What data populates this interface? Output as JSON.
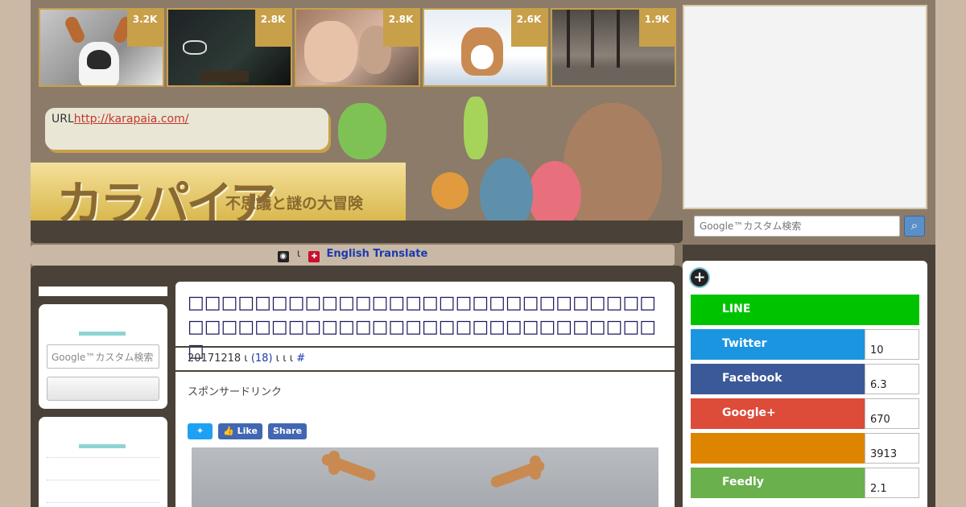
{
  "popular": [
    {
      "count": "3.2K",
      "subject": "husky-reindeer"
    },
    {
      "count": "2.8K",
      "subject": "night-photo"
    },
    {
      "count": "2.8K",
      "subject": "child-photo"
    },
    {
      "count": "2.6K",
      "subject": "corgi-snow"
    },
    {
      "count": "1.9K",
      "subject": "burnt-forest"
    }
  ],
  "header": {
    "url_label": "URL",
    "url_link": "http://karapaia.com/",
    "logo": "カラパイア",
    "tagline": "不思議と謎の大冒険"
  },
  "translate": {
    "sep": "ι",
    "link": "English Translate"
  },
  "search": {
    "placeholder": "Google™カスタム検索",
    "button_icon": "magnifier-icon"
  },
  "sidebar": {
    "search_placeholder": "Google™カスタム検索"
  },
  "article": {
    "title": "□□□□□□□□□□□□□□□□□□□□□□□□□□□□□□□□□□□□□□□□□□□□□□□□□□□□□□□□□",
    "meta_date": "20171218 ι",
    "meta_comments": "(18)",
    "meta_sep": " ι  ι    ι ",
    "meta_hash": "#",
    "sponsor": "スポンサードリンク",
    "share_fb_like": "Like",
    "share_fb_share": "Share"
  },
  "social": [
    {
      "name": "LINE",
      "count": "",
      "color": "#00c300"
    },
    {
      "name": "Twitter",
      "count": "10",
      "color": "#1b95e0"
    },
    {
      "name": "Facebook",
      "count": "6.3",
      "color": "#3b5998"
    },
    {
      "name": "Google+",
      "count": "670",
      "color": "#dd4b39"
    },
    {
      "name": "",
      "count": "3913",
      "color": "#dd8500"
    },
    {
      "name": "Feedly",
      "count": "2.1",
      "color": "#6cc655"
    }
  ]
}
